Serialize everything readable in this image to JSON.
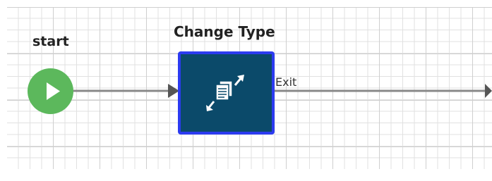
{
  "workflow": {
    "start_node": {
      "label": "start",
      "icon": "play-icon",
      "color": "#5cb85c"
    },
    "task_node": {
      "label": "Change Type",
      "icon": "change-type-icon",
      "fill": "#0b4a6a",
      "border": "#2c3bf0"
    },
    "exit_connector": {
      "label": "Exit"
    }
  }
}
